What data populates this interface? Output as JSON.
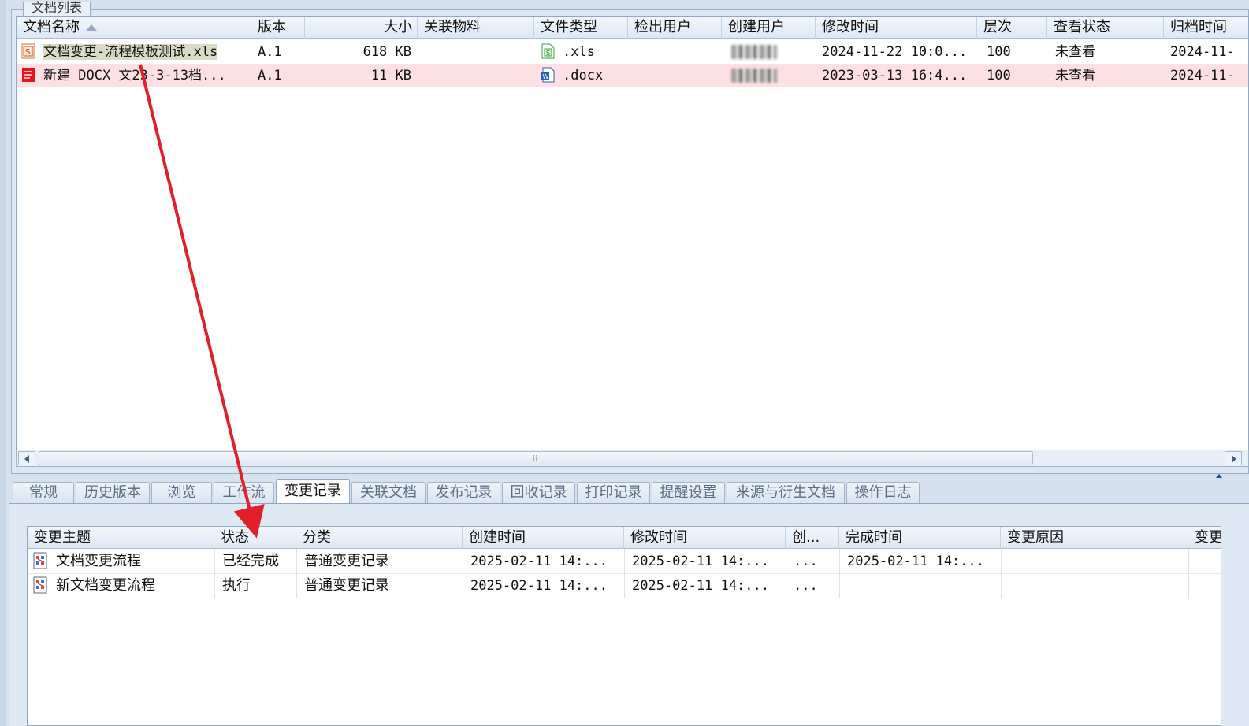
{
  "top_panel": {
    "tab_title": "文档列表",
    "columns": [
      "文档名称",
      "版本",
      "大小",
      "关联物料",
      "文件类型",
      "检出用户",
      "创建用户",
      "修改时间",
      "层次",
      "查看状态",
      "归档时间"
    ],
    "rows": [
      {
        "name": "文档变更-流程模板测试.xls",
        "version": "A.1",
        "size": "618 KB",
        "material": "",
        "type": ".xls",
        "checkout": "",
        "creator": "",
        "modified": "2024-11-22 10:0...",
        "level": "100",
        "view": "未查看",
        "archived": "2024-11-"
      },
      {
        "name": "新建 DOCX 文23-3-13档...",
        "version": "A.1",
        "size": "11 KB",
        "material": "",
        "type": ".docx",
        "checkout": "",
        "creator": "",
        "modified": "2023-03-13 16:4...",
        "level": "100",
        "view": "未查看",
        "archived": "2024-11-"
      }
    ]
  },
  "tabs": [
    "常规",
    "历史版本",
    "浏览",
    "工作流",
    "变更记录",
    "关联文档",
    "发布记录",
    "回收记录",
    "打印记录",
    "提醒设置",
    "来源与衍生文档",
    "操作日志"
  ],
  "active_tab": "变更记录",
  "change_grid": {
    "columns": [
      "变更主题",
      "状态",
      "分类",
      "创建时间",
      "修改时间",
      "创...",
      "完成时间",
      "变更原因",
      "变更"
    ],
    "rows": [
      {
        "subject": "文档变更流程",
        "status": "已经完成",
        "category": "普通变更记录",
        "created": "2025-02-11 14:...",
        "modified": "2025-02-11 14:...",
        "creator": "...",
        "completed": "2025-02-11 14:...",
        "reason": "",
        "more": ""
      },
      {
        "subject": "新文档变更流程",
        "status": "执行",
        "category": "普通变更记录",
        "created": "2025-02-11 14:...",
        "modified": "2025-02-11 14:...",
        "creator": "...",
        "completed": "",
        "reason": "",
        "more": ""
      }
    ]
  },
  "colors": {
    "annotation_arrow": "#e0202a",
    "selected_row": "#fde0e3",
    "selected_name": "#dadbc4"
  }
}
